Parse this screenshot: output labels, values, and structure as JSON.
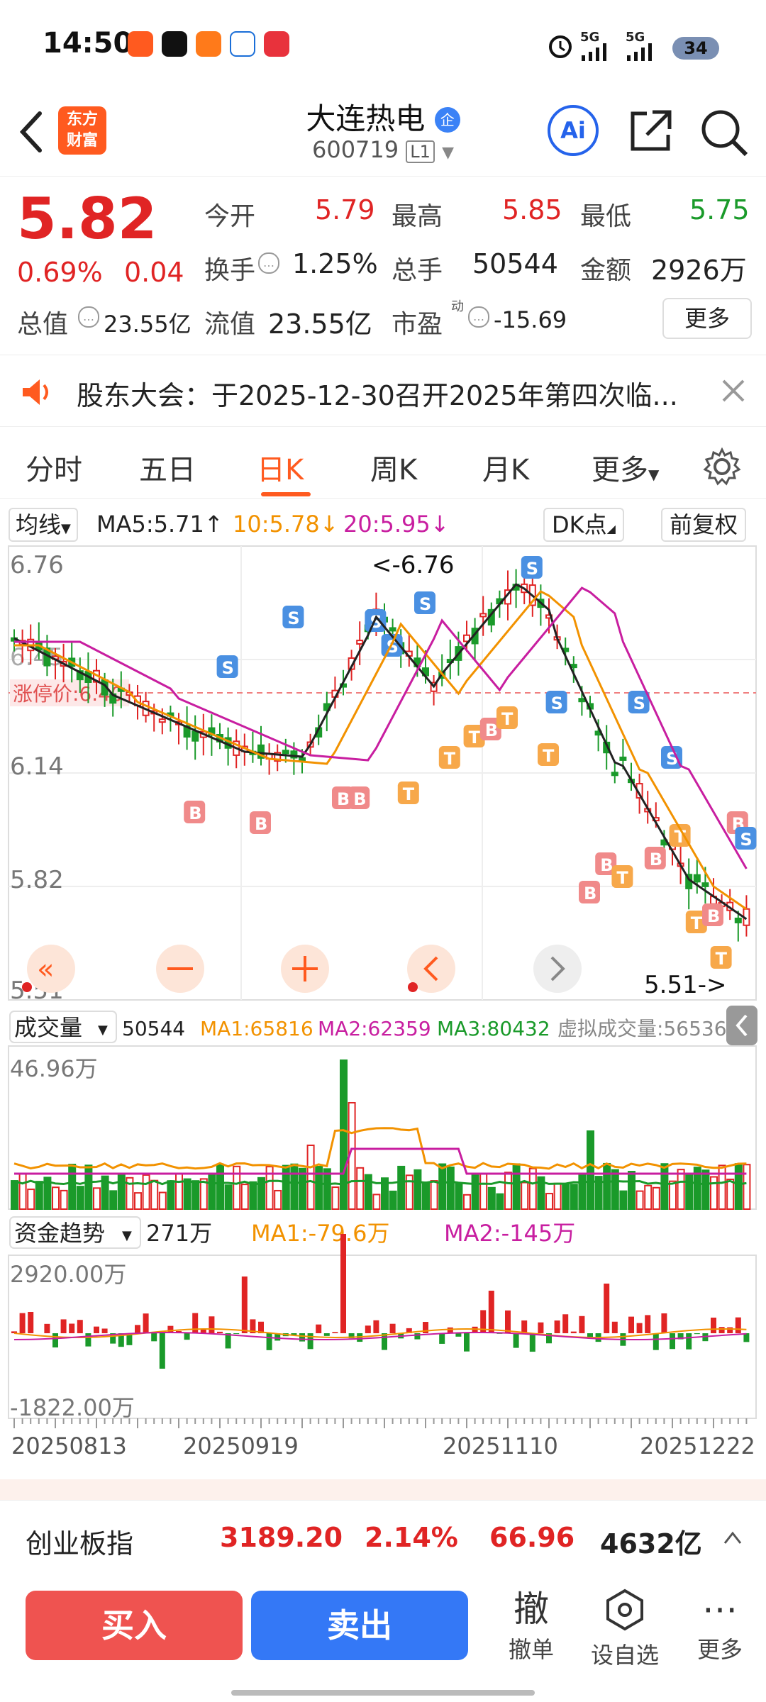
{
  "status": {
    "time": "14:50",
    "battery": "34",
    "net1": "5G",
    "net2": "5G"
  },
  "header": {
    "logo_line1": "东方",
    "logo_line2": "财富",
    "title": "大连热电",
    "badge": "企",
    "code": "600719",
    "level": "L1"
  },
  "quote": {
    "price": "5.82",
    "change_pct": "0.69%",
    "change": "0.04",
    "open_label": "今开",
    "open": "5.79",
    "high_label": "最高",
    "high": "5.85",
    "low_label": "最低",
    "low": "5.75",
    "turnover_label": "换手",
    "turnover": "1.25%",
    "volume_label": "总手",
    "volume": "50544",
    "amount_label": "金额",
    "amount": "2926万",
    "mktcap_label": "总值",
    "mktcap": "23.55亿",
    "float_label": "流值",
    "float": "23.55亿",
    "pe_label": "市盈",
    "pe_sup": "动",
    "pe": "-15.69",
    "more": "更多"
  },
  "notice": {
    "text": "股东大会：于2025-12-30召开2025年第四次临..."
  },
  "tabs": [
    "分时",
    "五日",
    "日K",
    "周K",
    "月K",
    "更多"
  ],
  "active_tab": "日K",
  "kline": {
    "ma_label": "均线",
    "ma5": "MA5:5.71",
    "ma10": "10:5.78",
    "ma20": "20:5.95",
    "dk_label": "DK点",
    "adjust_label": "前复权",
    "y_top": "6.76",
    "y_mid": "6.14",
    "y_low": "5.82",
    "y_bot": "5.51",
    "y_partial": "6.45",
    "limit_label": "涨停价:6.40",
    "max_label": "<-6.76",
    "min_label": "5.51->"
  },
  "volume": {
    "label": "成交量",
    "value": "50544",
    "ma1": "MA1:65816",
    "ma2": "MA2:62359",
    "ma3": "MA3:80432",
    "virtual": "虚拟成交量:56536",
    "top": "46.96万"
  },
  "capital": {
    "label": "资金趋势",
    "value": "271万",
    "ma1": "MA1:-79.6万",
    "ma2": "MA2:-145万",
    "top": "2920.00万",
    "bottom": "-1822.00万"
  },
  "dates": [
    "20250813",
    "20250919",
    "20251110",
    "20251222"
  ],
  "index_bar": {
    "name": "创业板指",
    "value": "3189.20",
    "pct": "2.14%",
    "change": "66.96",
    "amount": "4632亿"
  },
  "actions": {
    "buy": "买入",
    "sell": "卖出",
    "cancel_big": "撤",
    "cancel": "撤单",
    "watch": "设自选",
    "more": "更多"
  },
  "colors": {
    "up": "#e02424",
    "down": "#1a9a2a",
    "accent": "#ff5a1f",
    "sell_blue": "#3478f6"
  }
}
